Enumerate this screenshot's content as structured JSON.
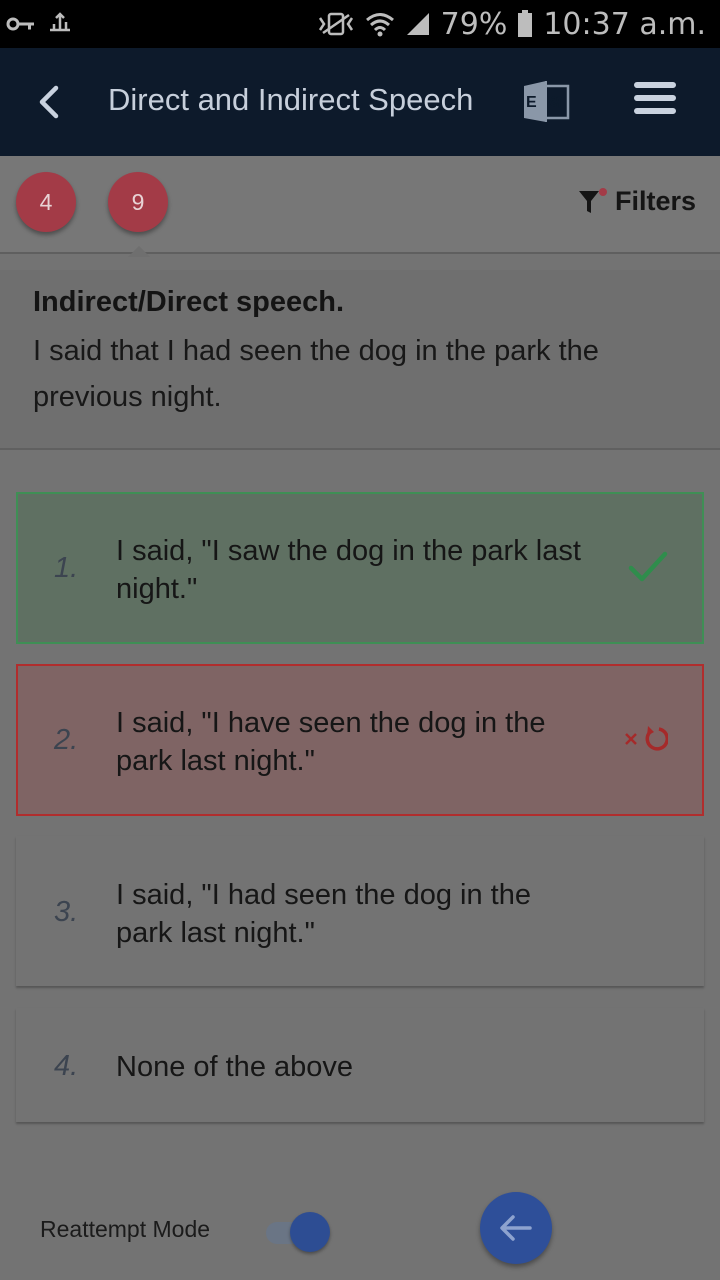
{
  "status_bar": {
    "battery": "79%",
    "time": "10:37 a.m.",
    "icons": [
      "key-icon",
      "usb-icon",
      "vibrate-icon",
      "wifi-icon",
      "signal-icon",
      "battery-icon"
    ]
  },
  "toolbar": {
    "title": "Direct and Indirect Speech",
    "language_badge": "E अ",
    "icons": [
      "back-arrow-icon",
      "language-toggle-icon",
      "hamburger-menu-icon"
    ]
  },
  "filter_bar": {
    "counters": [
      "4",
      "9"
    ],
    "filters_label": "Filters",
    "filter_icon": "funnel-icon"
  },
  "question": {
    "heading": "Indirect/Direct speech.",
    "text": "I said that I had seen the dog in the park the previous night."
  },
  "options": [
    {
      "number": "1.",
      "text": "I said, \"I saw the dog in the park last night.\"",
      "state": "correct",
      "icon": "checkmark-icon"
    },
    {
      "number": "2.",
      "text": "I said, \"I have seen the dog in the park last night.\"",
      "state": "wrong",
      "icon": "wrong-retry-icon"
    },
    {
      "number": "3.",
      "text": "I said, \"I had seen the dog in the park last night.\"",
      "state": "unanswered"
    },
    {
      "number": "4.",
      "text": "None of the above",
      "state": "unanswered"
    }
  ],
  "bottom": {
    "reattempt_label": "Reattempt Mode",
    "reattempt_enabled": true,
    "fab_icon": "left-arrow-icon"
  },
  "colors": {
    "toolbar": "#0d1a2b",
    "counter_badge": "#a33b47",
    "correct_border": "#3f8f55",
    "wrong_border": "#b12d2d",
    "accent_blue": "#2e4f99"
  }
}
